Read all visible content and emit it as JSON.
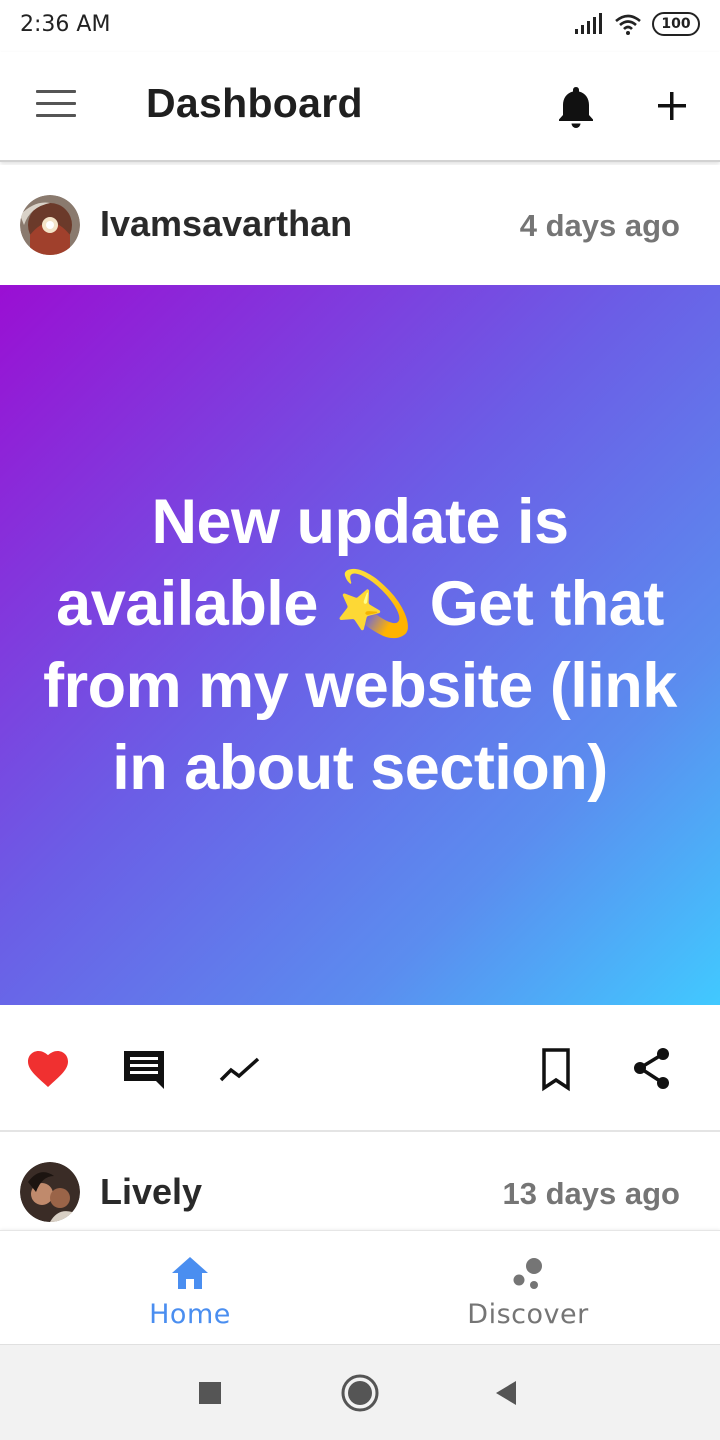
{
  "status_bar": {
    "time": "2:36 AM",
    "battery": "100"
  },
  "app_bar": {
    "title": "Dashboard"
  },
  "posts": [
    {
      "author": "Ivamsavarthan",
      "time_ago": "4 days ago",
      "text": "New update is available 💫 Get that from my website (link in about section)",
      "gradient_colors": [
        "#9a0fd3",
        "#41c9ff"
      ]
    },
    {
      "author": "Lively",
      "time_ago": "13 days ago"
    }
  ],
  "colors": {
    "like": "#f03030",
    "accent": "#4a8ef0",
    "inactive": "#757575"
  },
  "bottom_nav": {
    "items": [
      {
        "label": "Home",
        "icon": "home-icon",
        "active": true
      },
      {
        "label": "Discover",
        "icon": "discover-icon",
        "active": false
      }
    ]
  },
  "system_nav": {
    "icons": [
      "recents-icon",
      "home-circle-icon",
      "back-icon"
    ]
  }
}
